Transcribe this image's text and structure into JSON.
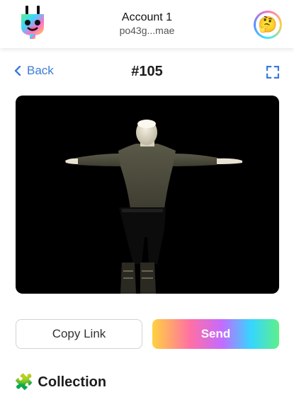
{
  "header": {
    "logo_icon": "plug-mascot-icon",
    "account_name": "Account 1",
    "account_address": "po43g...mae",
    "avatar_emoji": "🤔"
  },
  "nav": {
    "back_label": "Back",
    "title": "#105",
    "expand_icon": "fullscreen-icon"
  },
  "viewer": {
    "content": "3d-model-preview"
  },
  "actions": {
    "copy_link_label": "Copy Link",
    "send_label": "Send"
  },
  "section": {
    "icon": "🧩",
    "title": "Collection"
  },
  "colors": {
    "accent": "#3b7bd8",
    "viewer_bg": "#000000"
  }
}
